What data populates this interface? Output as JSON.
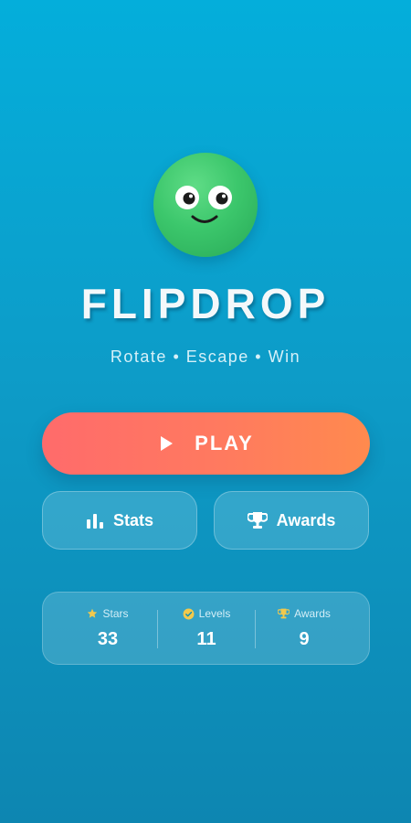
{
  "app": {
    "title": "FLIPDROP",
    "tagline": "Rotate • Escape • Win"
  },
  "mascot": {
    "icon": "smiling-green-ball-icon",
    "color": "#3cc76c"
  },
  "actions": {
    "play_label": "PLAY",
    "stats_label": "Stats",
    "awards_label": "Awards"
  },
  "summary": {
    "stars": {
      "label": "Stars",
      "value": "33",
      "icon": "star-icon"
    },
    "levels": {
      "label": "Levels",
      "value": "11",
      "icon": "check-circle-icon"
    },
    "awards": {
      "label": "Awards",
      "value": "9",
      "icon": "trophy-icon"
    }
  },
  "colors": {
    "background_top": "#04aedb",
    "background_bottom": "#0d86b1",
    "play_gradient_start": "#ff6b6b",
    "play_gradient_end": "#ff8a4e",
    "accent_yellow": "#f2c94c"
  }
}
